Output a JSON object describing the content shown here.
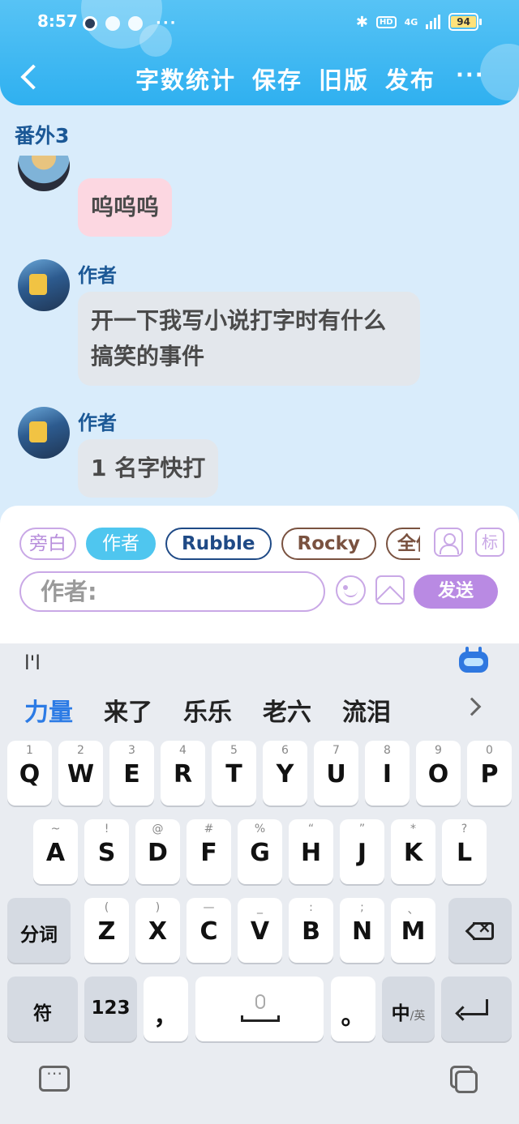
{
  "status_bar": {
    "time": "8:57",
    "overflow": "···",
    "hd": "HD",
    "network": "4G",
    "battery": "94"
  },
  "header": {
    "actions": [
      "字数统计",
      "保存",
      "旧版",
      "发布"
    ],
    "more": "···"
  },
  "chapter_title": "番外3",
  "messages": [
    {
      "sender": "",
      "text": "呜呜呜",
      "bubble": "pink",
      "avatar": "pup-avatar"
    },
    {
      "sender": "作者",
      "text": "开一下我写小说打字时有什么搞笑的事件",
      "bubble": "grey",
      "avatar": "game-avatar"
    },
    {
      "sender": "作者",
      "text": "1 名字快打",
      "bubble": "grey",
      "avatar": "game-avatar"
    }
  ],
  "compose": {
    "roles": [
      "旁白",
      "作者",
      "Rubble",
      "Rocky",
      "全体"
    ],
    "selected_role": "作者",
    "input_value": "作者:",
    "tag_label": "标",
    "send_label": "发送"
  },
  "keyboard": {
    "composition": "l'l",
    "candidates": [
      "力量",
      "来了",
      "乐乐",
      "老六",
      "流泪"
    ],
    "row1": {
      "keys": [
        "Q",
        "W",
        "E",
        "R",
        "T",
        "Y",
        "U",
        "I",
        "O",
        "P"
      ],
      "subs": [
        "1",
        "2",
        "3",
        "4",
        "5",
        "6",
        "7",
        "8",
        "9",
        "0"
      ]
    },
    "row2": {
      "keys": [
        "A",
        "S",
        "D",
        "F",
        "G",
        "H",
        "J",
        "K",
        "L"
      ],
      "subs": [
        "~",
        "!",
        "@",
        "#",
        "%",
        "“",
        "”",
        "*",
        "?"
      ]
    },
    "row3": {
      "shift": "分词",
      "keys": [
        "Z",
        "X",
        "C",
        "V",
        "B",
        "N",
        "M"
      ],
      "subs": [
        "(",
        ")",
        "—",
        "_",
        ":",
        ";",
        "、"
      ]
    },
    "row4": {
      "symbols": "符",
      "numbers": "123",
      "comma": "，",
      "period": "。",
      "lang": "中",
      "lang_sub": "/英"
    }
  },
  "colors": {
    "header": "#2fb0f0",
    "accent_purple": "#b98ae3",
    "chip_active": "#4fc6ef",
    "sender_blue": "#1b5896"
  }
}
